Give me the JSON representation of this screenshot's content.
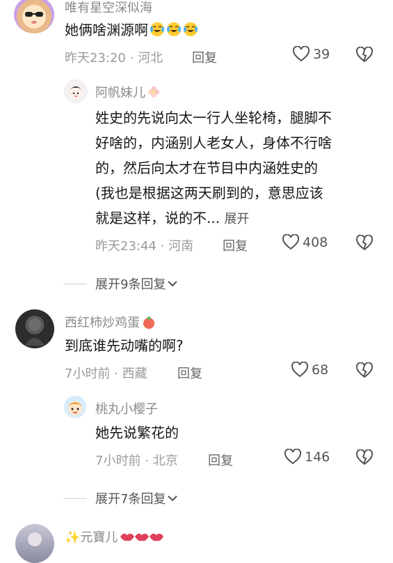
{
  "comments": [
    {
      "username": "唯有星空深似海",
      "text": "她俩啥渊源啊",
      "emoji_icons": [
        "crying-laughing-emoji",
        "crying-laughing-emoji",
        "crying-laughing-emoji"
      ],
      "time": "昨天23:20",
      "location": "河北",
      "reply_label": "回复",
      "likes": "39"
    },
    {
      "username": "阿帆妹儿",
      "name_suffix_icon": "flower-emoji",
      "text_lines": [
        "姓史的先说向太一行人坐轮椅，腿脚不",
        "好啥的，内涵别人老女人，身体不行啥",
        "的，然后向太才在节目中内涵姓史的",
        "(我也是根据这两天刷到的，意思应该",
        "就是这样，说的不..."
      ],
      "expand_label": "展开",
      "time": "昨天23:44",
      "location": "河南",
      "reply_label": "回复",
      "likes": "408"
    },
    {
      "username": "西红柿炒鸡蛋",
      "name_suffix_icon": "tomato-emoji",
      "text": "到底谁先动嘴的啊?",
      "time": "7小时前",
      "location": "西藏",
      "reply_label": "回复",
      "likes": "68"
    },
    {
      "username": "桃丸小樱子",
      "text": "她先说繁花的",
      "time": "7小时前",
      "location": "北京",
      "reply_label": "回复",
      "likes": "146"
    },
    {
      "username": "✨元寶儿",
      "name_suffix_icon": "lips-emoji"
    }
  ],
  "expand_replies": [
    "展开9条回复",
    "展开7条回复"
  ],
  "separator": "·",
  "colors": {
    "username": "#8a8a8a",
    "meta": "#9a9a9a",
    "text": "#161616"
  }
}
